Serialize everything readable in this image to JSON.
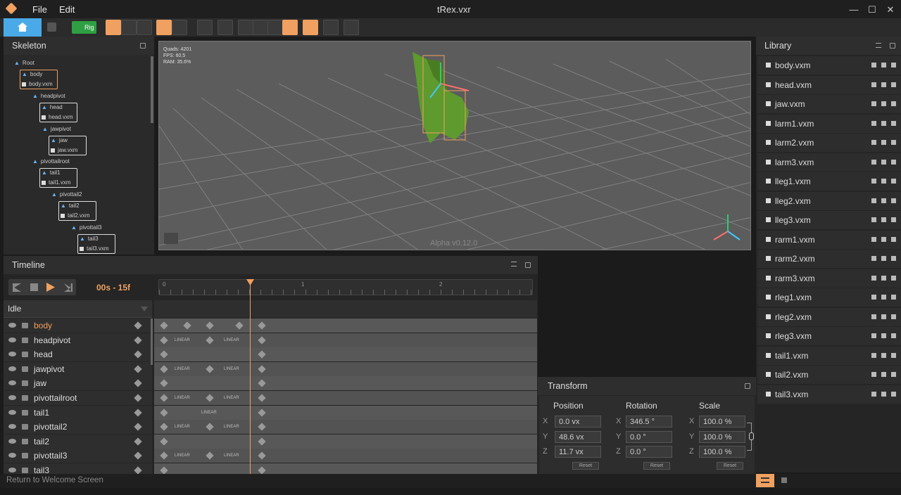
{
  "menu": {
    "file": "File",
    "edit": "Edit"
  },
  "window": {
    "title": "tRex.vxr"
  },
  "toolbar": {
    "rig_label": "Rig"
  },
  "skeleton": {
    "title": "Skeleton",
    "nodes": [
      {
        "label": "Root"
      },
      {
        "label": "body",
        "model": "body.vxm"
      },
      {
        "label": "headpivot"
      },
      {
        "label": "head",
        "model": "head.vxm"
      },
      {
        "label": "jawpivot"
      },
      {
        "label": "jaw",
        "model": "jaw.vxm"
      },
      {
        "label": "pivottailroot"
      },
      {
        "label": "tail1",
        "model": "tail1.vxm"
      },
      {
        "label": "pivottail2"
      },
      {
        "label": "tail2",
        "model": "tail2.vxm"
      },
      {
        "label": "pivottail3"
      },
      {
        "label": "tail3",
        "model": "tail3.vxm"
      }
    ]
  },
  "viewport": {
    "stats": [
      "Quads: 4201",
      "FPS: 60.5",
      "RAM: 35.6%"
    ],
    "version": "Alpha v0.12.0"
  },
  "timeline": {
    "title": "Timeline",
    "time": "00s - 15f",
    "ruler": [
      "0",
      "1",
      "2"
    ],
    "animation": "Idle",
    "bones": [
      "body",
      "headpivot",
      "head",
      "jawpivot",
      "jaw",
      "pivottailroot",
      "tail1",
      "pivottail2",
      "tail2",
      "pivottail3",
      "tail3"
    ],
    "interp_label": "LINEAR"
  },
  "library": {
    "title": "Library",
    "items": [
      "body.vxm",
      "head.vxm",
      "jaw.vxm",
      "larm1.vxm",
      "larm2.vxm",
      "larm3.vxm",
      "lleg1.vxm",
      "lleg2.vxm",
      "lleg3.vxm",
      "rarm1.vxm",
      "rarm2.vxm",
      "rarm3.vxm",
      "rleg1.vxm",
      "rleg2.vxm",
      "rleg3.vxm",
      "tail1.vxm",
      "tail2.vxm",
      "tail3.vxm"
    ]
  },
  "transform": {
    "title": "Transform",
    "position_label": "Position",
    "rotation_label": "Rotation",
    "scale_label": "Scale",
    "axes": [
      "X",
      "Y",
      "Z"
    ],
    "position": [
      "0.0 vx",
      "48.6 vx",
      "11.7 vx"
    ],
    "rotation": [
      "346.5 °",
      "0.0 °",
      "0.0 °"
    ],
    "scale": [
      "100.0 %",
      "100.0 %",
      "100.0 %"
    ],
    "reset_label": "Reset"
  },
  "status": {
    "text": "Return to Welcome Screen"
  },
  "colors": {
    "accent": "#f0a060",
    "rig": "#2ea043",
    "bone": "#6ab6ff"
  }
}
